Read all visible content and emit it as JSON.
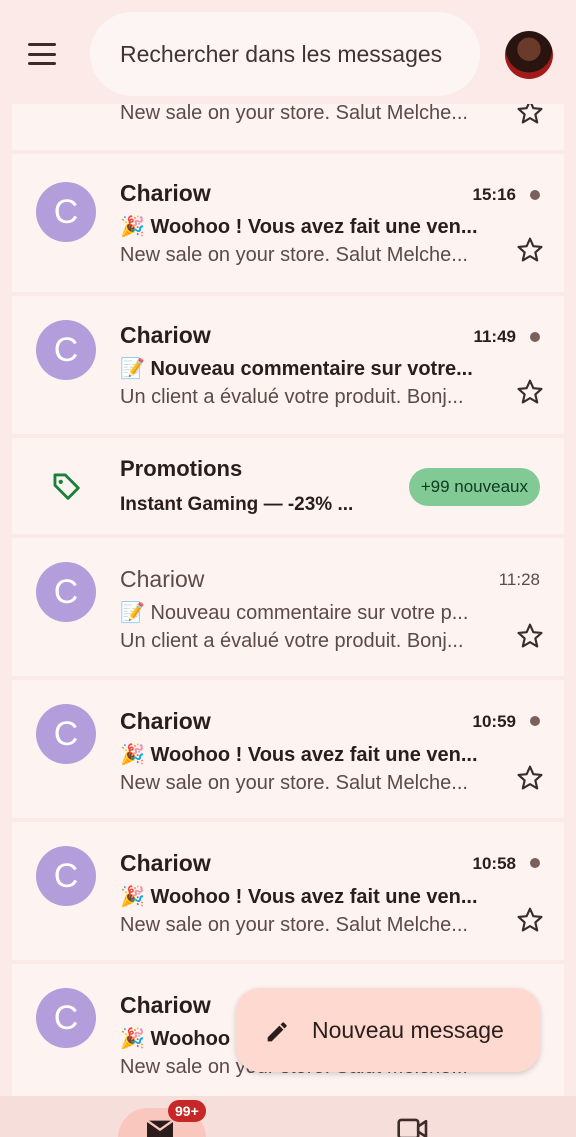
{
  "search": {
    "placeholder": "Rechercher dans les messages"
  },
  "emails": [
    {
      "snippet": "New sale on your store. Salut Melche..."
    },
    {
      "initial": "C",
      "sender": "Chariow",
      "time": "15:16",
      "emoji": "🎉",
      "subject": "Woohoo ! Vous avez fait une ven...",
      "snippet": "New sale on your store. Salut Melche...",
      "unread": true
    },
    {
      "initial": "C",
      "sender": "Chariow",
      "time": "11:49",
      "emoji": "📝",
      "subject": "Nouveau commentaire sur votre...",
      "snippet": "Un client a évalué votre produit. Bonj...",
      "unread": true
    },
    {
      "initial": "C",
      "sender": "Chariow",
      "time": "11:28",
      "emoji": "📝",
      "subject": "Nouveau commentaire sur votre p...",
      "snippet": "Un client a évalué votre produit. Bonj...",
      "unread": false
    },
    {
      "initial": "C",
      "sender": "Chariow",
      "time": "10:59",
      "emoji": "🎉",
      "subject": "Woohoo ! Vous avez fait une ven...",
      "snippet": "New sale on your store. Salut Melche...",
      "unread": true
    },
    {
      "initial": "C",
      "sender": "Chariow",
      "time": "10:58",
      "emoji": "🎉",
      "subject": "Woohoo ! Vous avez fait une ven...",
      "snippet": "New sale on your store. Salut Melche...",
      "unread": true
    },
    {
      "initial": "C",
      "sender": "Chariow",
      "emoji": "🎉",
      "subject": "Woohoo",
      "snippet": "New sale on your store. Salut Melche...",
      "unread": true
    }
  ],
  "promotions": {
    "title": "Promotions",
    "subtitle": "Instant Gaming — -23% ...",
    "badge": "+99 nouveaux"
  },
  "fab": {
    "label": "Nouveau message"
  },
  "bottom_nav": {
    "mail_badge": "99+"
  },
  "colors": {
    "avatar": "#b39ddb",
    "promo_badge": "#81c995",
    "fab": "#fdd9d0",
    "badge": "#c62828"
  }
}
